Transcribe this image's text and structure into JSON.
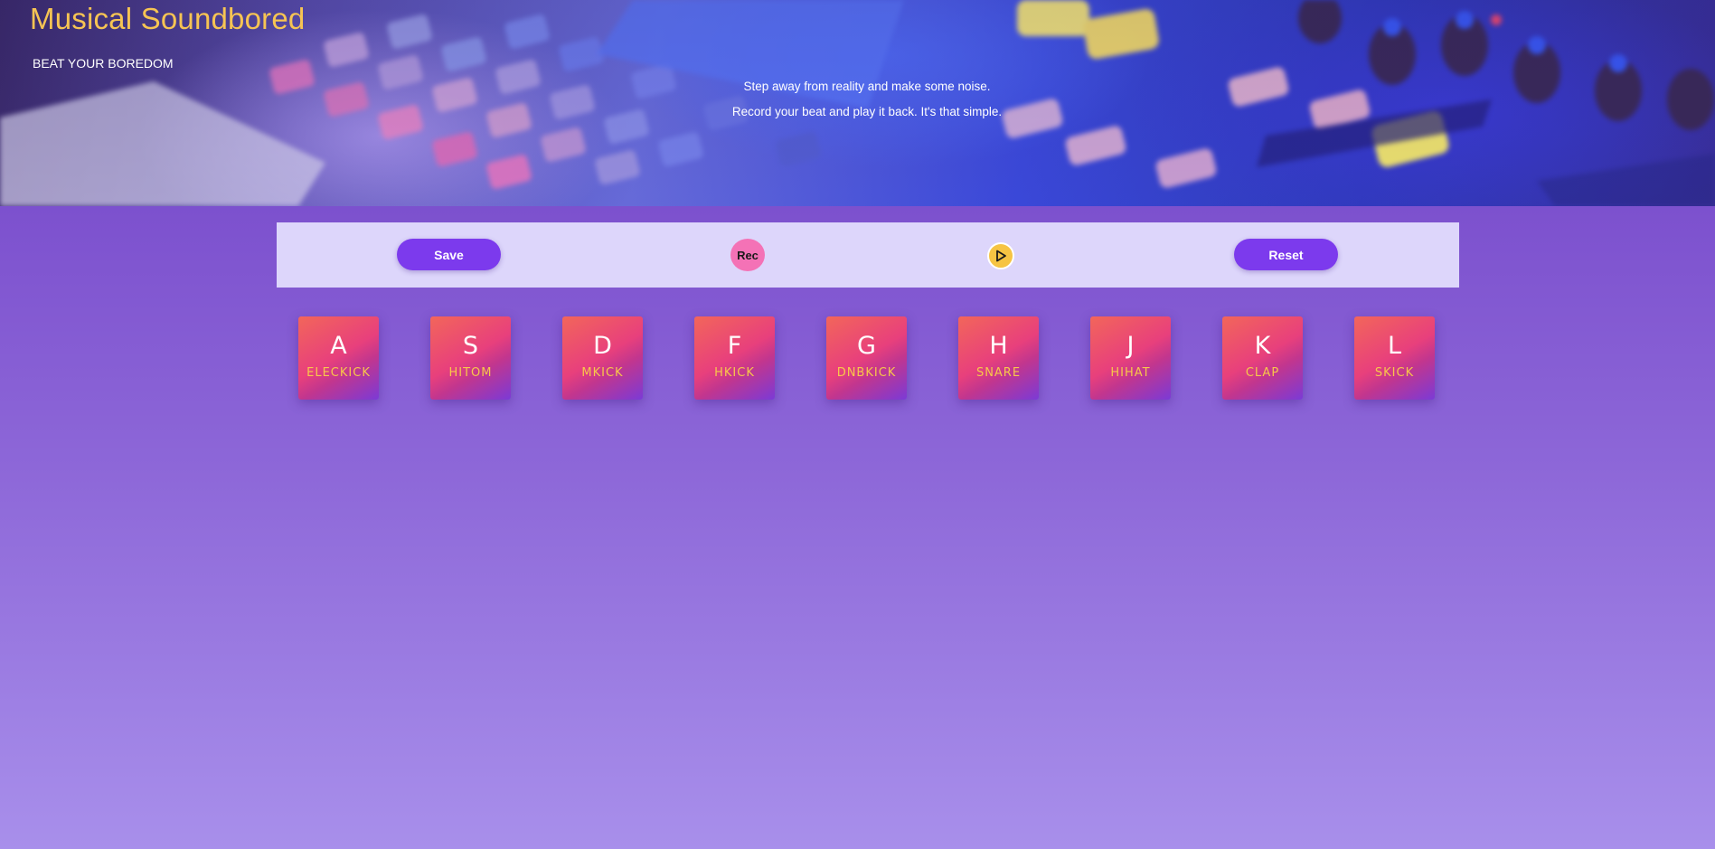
{
  "header": {
    "title": "Musical Soundbored",
    "subtitle": "BEAT YOUR BOREDOM",
    "tagline_line1": "Step away from reality and make some noise.",
    "tagline_line2": "Record your beat and play it back. It's that simple."
  },
  "controls": {
    "save_label": "Save",
    "rec_label": "Rec",
    "play_icon": "play-icon",
    "reset_label": "Reset"
  },
  "pads": [
    {
      "key": "A",
      "sound": "ELECKICK"
    },
    {
      "key": "S",
      "sound": "HITOM"
    },
    {
      "key": "D",
      "sound": "MKICK"
    },
    {
      "key": "F",
      "sound": "HKICK"
    },
    {
      "key": "G",
      "sound": "DNBKICK"
    },
    {
      "key": "H",
      "sound": "SNARE"
    },
    {
      "key": "J",
      "sound": "HIHAT"
    },
    {
      "key": "K",
      "sound": "CLAP"
    },
    {
      "key": "L",
      "sound": "SKICK"
    }
  ],
  "colors": {
    "title": "#f6c453",
    "accent_purple": "#7c3aed",
    "rec_pink": "#f472b6",
    "play_yellow": "#f6c443",
    "controls_bg": "#ddd6fb",
    "pad_label": "#f8c74a"
  }
}
